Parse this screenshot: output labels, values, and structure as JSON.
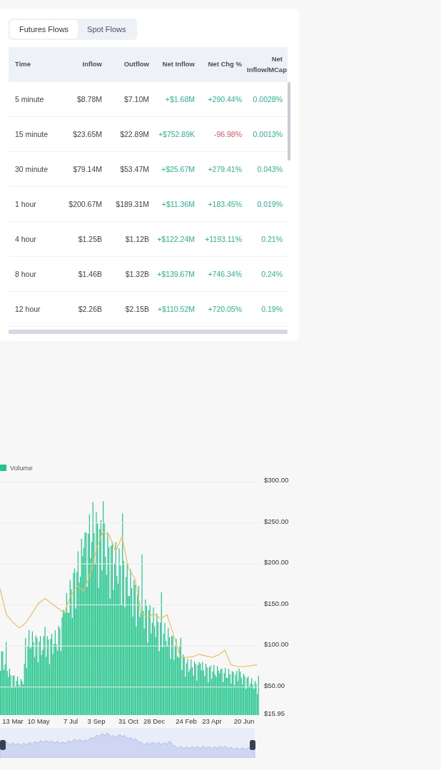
{
  "tabs": [
    {
      "label": "Futures Flows",
      "selected": true
    },
    {
      "label": "Spot Flows",
      "selected": false
    }
  ],
  "table": {
    "columns": [
      "Time",
      "Inflow",
      "Outflow",
      "Net Inflow",
      "Net Chg %",
      "Net Inflow/MCap"
    ],
    "rows": [
      {
        "time": "5 minute",
        "inflow": "$8.78M",
        "outflow": "$7.10M",
        "net_inflow": "+$1.68M",
        "net_chg": "+290.44%",
        "net_mcap": "0.0028%",
        "chg_negative": false
      },
      {
        "time": "15 minute",
        "inflow": "$23.65M",
        "outflow": "$22.89M",
        "net_inflow": "+$752.89K",
        "net_chg": "-96.98%",
        "net_mcap": "0.0013%",
        "chg_negative": true
      },
      {
        "time": "30 minute",
        "inflow": "$79.14M",
        "outflow": "$53.47M",
        "net_inflow": "+$25.67M",
        "net_chg": "+279.41%",
        "net_mcap": "0.043%",
        "chg_negative": false
      },
      {
        "time": "1 hour",
        "inflow": "$200.67M",
        "outflow": "$189.31M",
        "net_inflow": "+$11.36M",
        "net_chg": "+183.45%",
        "net_mcap": "0.019%",
        "chg_negative": false
      },
      {
        "time": "4 hour",
        "inflow": "$1.25B",
        "outflow": "$1.12B",
        "net_inflow": "+$122.24M",
        "net_chg": "+1193.11%",
        "net_mcap": "0.21%",
        "chg_negative": false
      },
      {
        "time": "8 hour",
        "inflow": "$1.46B",
        "outflow": "$1.32B",
        "net_inflow": "+$139.67M",
        "net_chg": "+746.34%",
        "net_mcap": "0.24%",
        "chg_negative": false
      },
      {
        "time": "12 hour",
        "inflow": "$2.26B",
        "outflow": "$2.15B",
        "net_inflow": "+$110.52M",
        "net_chg": "+720.05%",
        "net_mcap": "0.19%",
        "chg_negative": false
      }
    ]
  },
  "chart": {
    "legend": "Volume",
    "chart_data": {
      "type": "line",
      "grid": true,
      "ylim": [
        15.95,
        300
      ],
      "yticks": [
        {
          "value": 300,
          "label": "$300.00"
        },
        {
          "value": 250,
          "label": "$250.00"
        },
        {
          "value": 200,
          "label": "$200.00"
        },
        {
          "value": 150,
          "label": "$150.00"
        },
        {
          "value": 100,
          "label": "$100.00"
        },
        {
          "value": 50,
          "label": "$50.00"
        },
        {
          "value": 15.95,
          "label": "$15.95"
        }
      ],
      "categories": [
        null,
        null,
        "13 Mar",
        null,
        null,
        null,
        "10 May",
        null,
        null,
        null,
        null,
        "7 Jul",
        null,
        null,
        null,
        "3 Sep",
        null,
        null,
        null,
        null,
        "31 Oct",
        null,
        null,
        null,
        "28 Dec",
        null,
        null,
        null,
        null,
        "24 Feb",
        null,
        null,
        null,
        "23 Apr",
        null,
        null,
        null,
        null,
        "20 Jun",
        null,
        null
      ],
      "series": [
        {
          "color": "#e8c06a",
          "values": [
            170,
            138,
            129,
            122,
            128,
            140,
            152,
            158,
            152,
            146,
            140,
            161,
            173,
            167,
            186,
            218,
            239,
            235,
            215,
            233,
            195,
            182,
            140,
            135,
            139,
            133,
            138,
            114,
            88,
            86,
            87,
            90,
            88,
            86,
            89,
            95,
            77,
            75,
            75,
            76,
            77
          ]
        }
      ]
    }
  }
}
